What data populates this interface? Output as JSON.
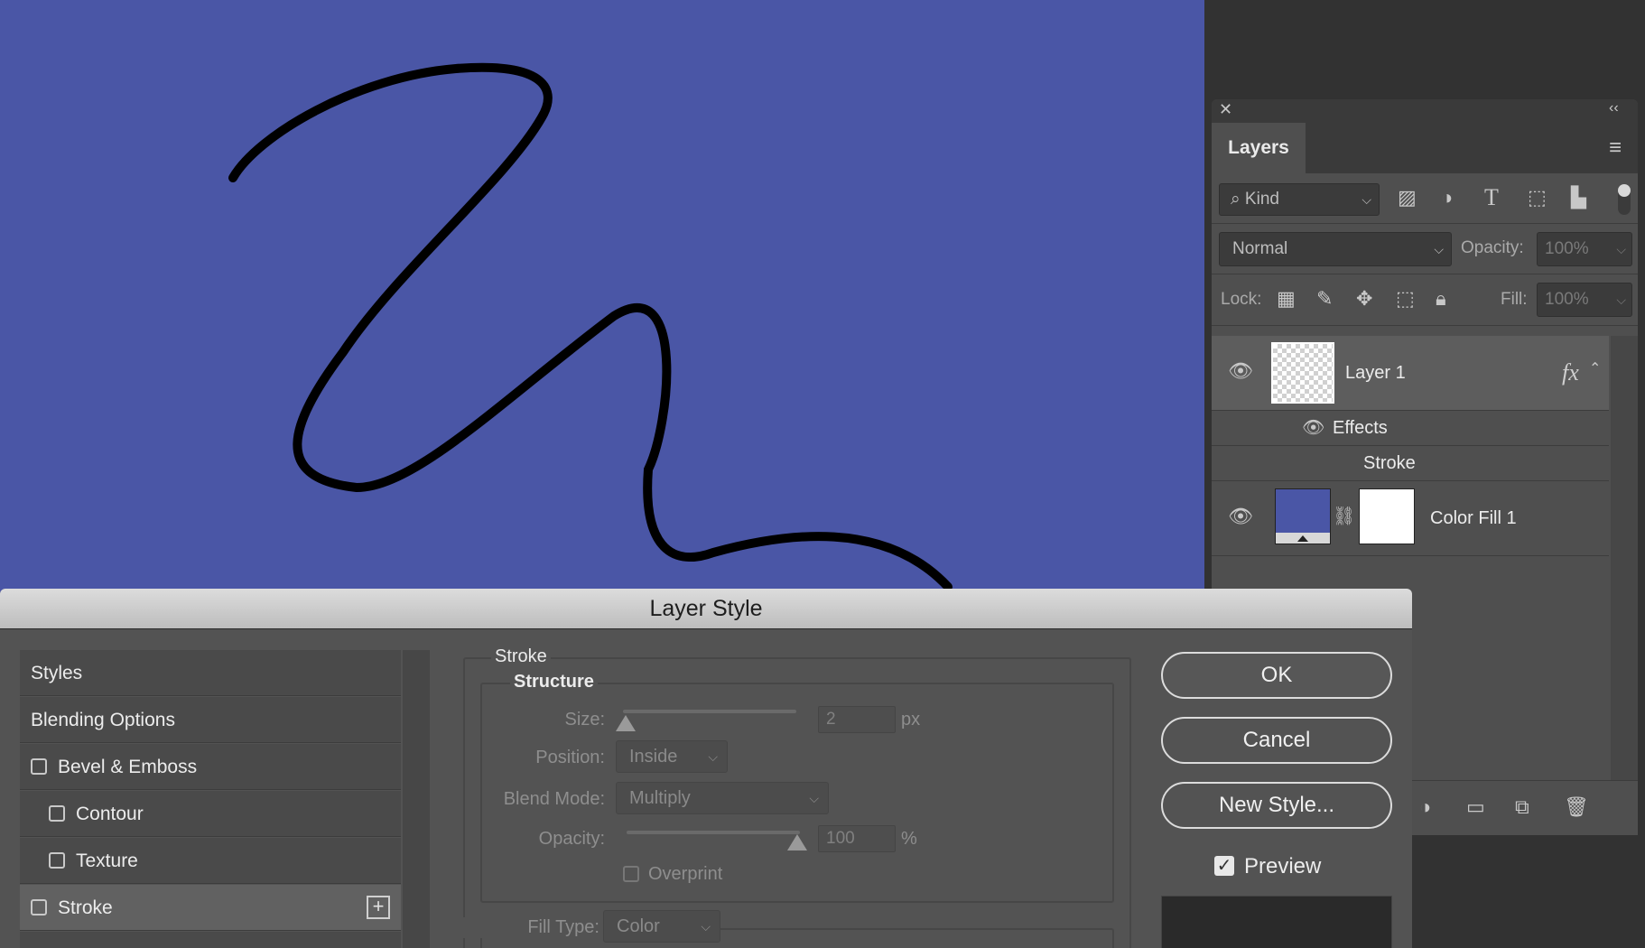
{
  "layers_panel": {
    "tab_label": "Layers",
    "filter": {
      "kind_label": "Kind"
    },
    "blend_mode": "Normal",
    "opacity_label": "Opacity:",
    "opacity_value": "100%",
    "lock_label": "Lock:",
    "fill_label": "Fill:",
    "fill_value": "100%",
    "layers": [
      {
        "name": "Layer 1",
        "fx": "fx",
        "effects_label": "Effects",
        "effect_item": "Stroke"
      },
      {
        "name": "Color Fill 1"
      }
    ],
    "fill_color": "#4a56a6"
  },
  "dialog": {
    "title": "Layer Style",
    "styles_list": [
      {
        "label": "Styles"
      },
      {
        "label": "Blending Options"
      },
      {
        "label": "Bevel & Emboss",
        "checked": false
      },
      {
        "label": "Contour",
        "checked": false
      },
      {
        "label": "Texture",
        "checked": false
      },
      {
        "label": "Stroke",
        "checked": false
      }
    ],
    "stroke": {
      "group_title": "Stroke",
      "structure_title": "Structure",
      "size_label": "Size:",
      "size_value": "2",
      "size_unit": "px",
      "position_label": "Position:",
      "position_value": "Inside",
      "blend_mode_label": "Blend Mode:",
      "blend_mode_value": "Multiply",
      "opacity_label": "Opacity:",
      "opacity_value": "100",
      "opacity_unit": "%",
      "overprint_label": "Overprint",
      "fill_type_label": "Fill Type:",
      "fill_type_value": "Color"
    },
    "buttons": {
      "ok": "OK",
      "cancel": "Cancel",
      "new_style": "New Style...",
      "preview_label": "Preview",
      "preview_checked": true
    }
  },
  "colors": {
    "canvas": "#4a56a6",
    "ui_dark": "#262626",
    "panel": "#4f4f4f"
  }
}
